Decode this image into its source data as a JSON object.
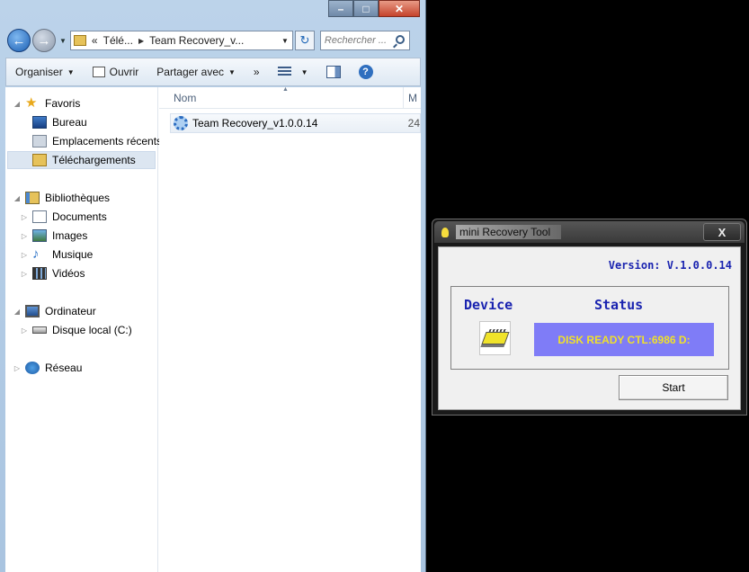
{
  "explorer": {
    "caption": {
      "minimize": "–",
      "maximize": "□",
      "close": "✕"
    },
    "address": {
      "overflow": "«",
      "part1": "Télé...",
      "part2": "Team Recovery_v..."
    },
    "search_placeholder": "Rechercher ...",
    "toolbar": {
      "organize": "Organiser",
      "open": "Ouvrir",
      "share": "Partager avec",
      "more": "»"
    },
    "nav": {
      "favorites": "Favoris",
      "desktop": "Bureau",
      "recent": "Emplacements récents",
      "downloads": "Téléchargements",
      "libraries": "Bibliothèques",
      "documents": "Documents",
      "images": "Images",
      "music": "Musique",
      "videos": "Vidéos",
      "computer": "Ordinateur",
      "local_disk": "Disque local (C:)",
      "network": "Réseau"
    },
    "columns": {
      "name": "Nom",
      "next": "M"
    },
    "files": [
      {
        "name": "Team Recovery_v1.0.0.14",
        "size_partial": "24"
      }
    ]
  },
  "tool": {
    "title": "mini Recovery Tool",
    "close": "X",
    "version": "Version: V.1.0.0.14",
    "device_header": "Device",
    "status_header": "Status",
    "status_text": "DISK READY CTL:6986 D:",
    "start_label": "Start"
  },
  "colors": {
    "status_bg": "#7f7cf7",
    "status_fg": "#f0e12a",
    "heading_blue": "#1a24b0",
    "selection": "#dce6f1"
  },
  "icons": [
    "search-icon",
    "refresh-icon",
    "star-icon",
    "folder-icon",
    "gear-icon",
    "chip-icon",
    "bulb-icon",
    "help-icon"
  ]
}
